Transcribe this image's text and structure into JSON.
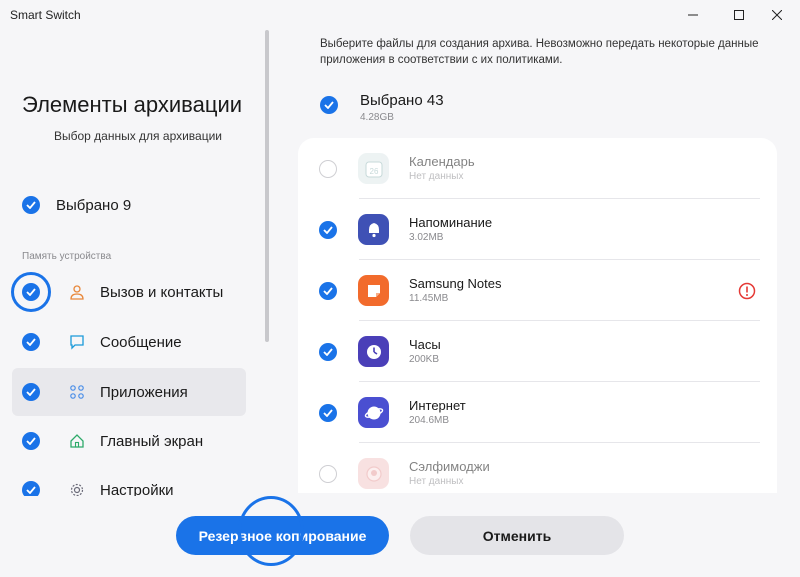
{
  "window": {
    "title": "Smart Switch"
  },
  "left": {
    "title": "Элементы архивации",
    "subtitle": "Выбор данных для архивации",
    "select_all_label": "Выбрано 9",
    "section_label": "Память устройства",
    "categories": [
      {
        "label": "Вызов и контакты",
        "icon": "person-icon",
        "checked": true
      },
      {
        "label": "Сообщение",
        "icon": "message-icon",
        "checked": true
      },
      {
        "label": "Приложения",
        "icon": "apps-grid-icon",
        "checked": true,
        "active": true
      },
      {
        "label": "Главный экран",
        "icon": "home-icon",
        "checked": true
      },
      {
        "label": "Настройки",
        "icon": "gear-icon",
        "checked": true
      }
    ]
  },
  "right": {
    "info_text": "Выберите файлы для создания архива. Невозможно передать некоторые данные приложения в соответствии с их политиками.",
    "select_all_label": "Выбрано 43",
    "select_all_size": "4.28GB",
    "apps": [
      {
        "name": "Календарь",
        "size": "Нет данных",
        "checked": false,
        "icon": "calendar-icon",
        "color": "#dfe9ea"
      },
      {
        "name": "Напоминание",
        "size": "3.02MB",
        "checked": true,
        "icon": "bell-icon",
        "color": "#3f51b5"
      },
      {
        "name": "Samsung Notes",
        "size": "11.45MB",
        "checked": true,
        "icon": "notes-icon",
        "color": "#f26b2c",
        "warning": true
      },
      {
        "name": "Часы",
        "size": "200KB",
        "checked": true,
        "icon": "clock-icon",
        "color": "#4a3fb8"
      },
      {
        "name": "Интернет",
        "size": "204.6MB",
        "checked": true,
        "icon": "internet-icon",
        "color": "#4a4fd1"
      },
      {
        "name": "Сэлфимоджи",
        "size": "Нет данных",
        "checked": false,
        "icon": "selfiemoji-icon",
        "color": "#f3c9c9"
      }
    ]
  },
  "buttons": {
    "backup": "Резервное копирование",
    "cancel": "Отменить"
  },
  "colors": {
    "accent": "#1a73e8",
    "background": "#f6f6f8",
    "warning": "#e53935"
  }
}
